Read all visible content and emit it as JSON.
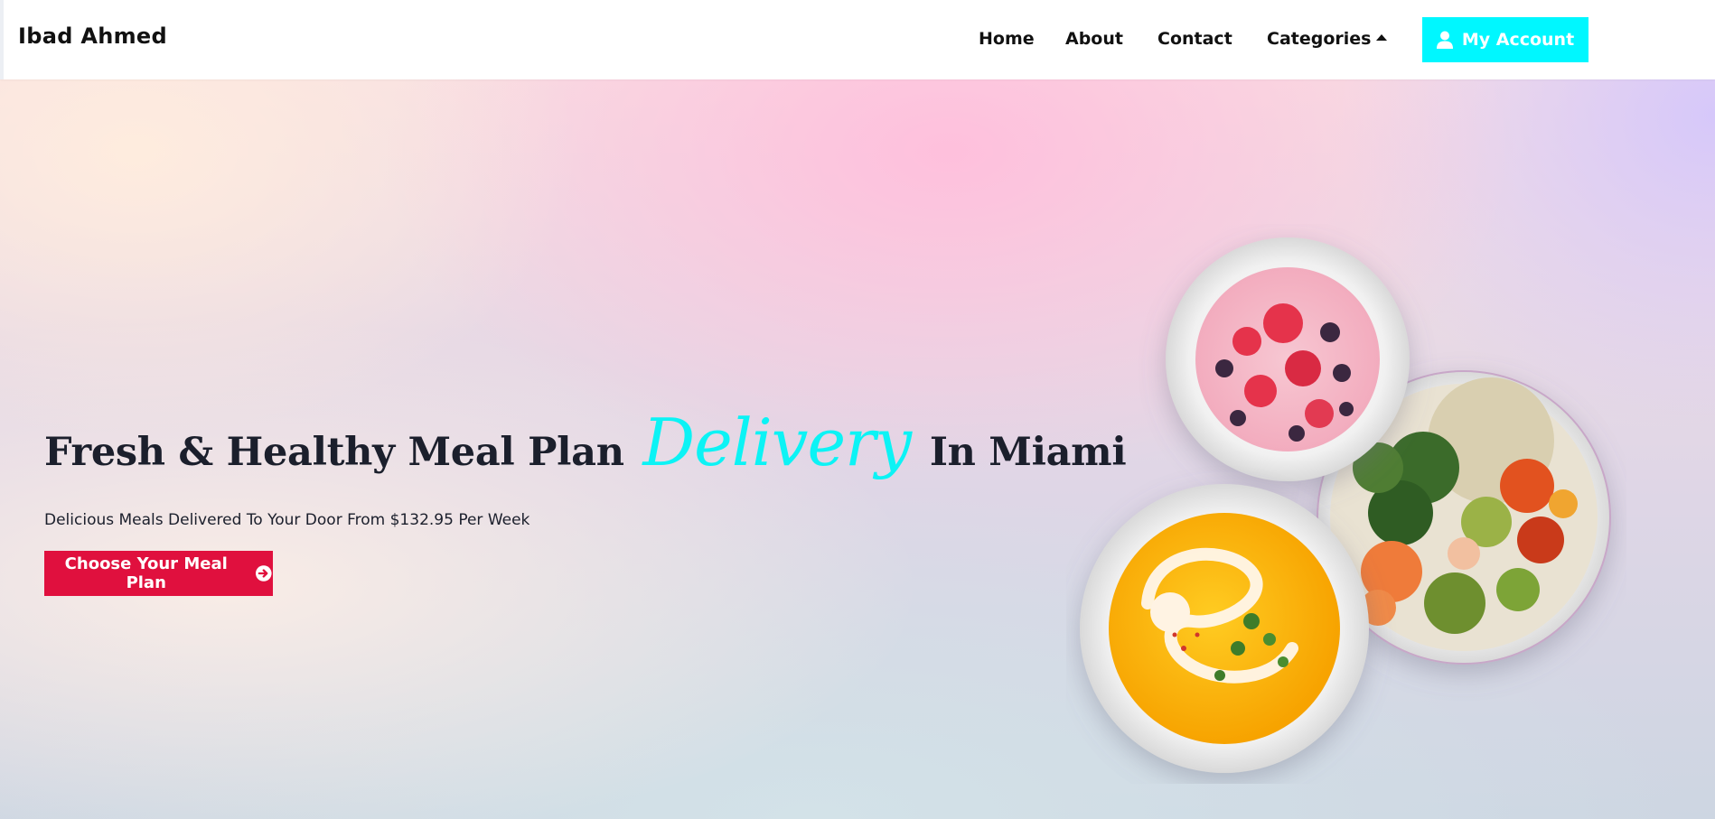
{
  "header": {
    "brand": "Ibad Ahmed",
    "nav": {
      "home": "Home",
      "about": "About",
      "contact": "Contact",
      "categories": "Categories"
    },
    "account_button": "My Account"
  },
  "hero": {
    "title_start": "Fresh & Healthy Meal Plan",
    "title_accent": "Delivery",
    "title_end": "In Miami",
    "subtitle": "Delicious Meals Delivered To Your Door From $132.95 Per Week",
    "cta_label": "Choose Your Meal Plan"
  },
  "colors": {
    "accent_cyan": "#00f7ff",
    "cta_red": "#e0103e",
    "text_dark": "#1b1f2c"
  },
  "icons": [
    "caret-up-icon",
    "user-icon",
    "arrow-circle-right-icon"
  ]
}
